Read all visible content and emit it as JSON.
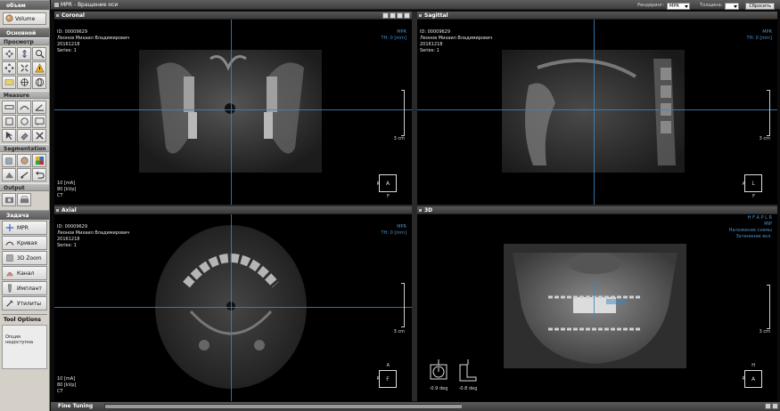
{
  "sidebar": {
    "volume_panel": {
      "title": "объем",
      "button_label": "Volume"
    },
    "main_panel": {
      "title": "Основной"
    },
    "sections": {
      "view": "Просмотр",
      "measure": "Measure",
      "segmentation": "Segmentation",
      "output": "Output"
    },
    "task_panel": {
      "title": "Задача",
      "items": [
        {
          "label": "MPR",
          "icon": "mpr-icon"
        },
        {
          "label": "Кривая",
          "icon": "curve-icon"
        },
        {
          "label": "3D Zoom",
          "icon": "zoom-3d-icon"
        },
        {
          "label": "Канал",
          "icon": "canal-icon"
        },
        {
          "label": "Имплант",
          "icon": "implant-icon"
        },
        {
          "label": "Утилиты",
          "icon": "utilities-icon"
        }
      ]
    },
    "tool_options": {
      "title": "Tool Options",
      "text": "Опция недоступна"
    }
  },
  "topbar": {
    "title": "MPR - Вращение оси",
    "render_label": "Рендеринг:",
    "render_value": "MPR",
    "thickness_label": "Толщина:",
    "thickness_value": "",
    "reset_label": "Сбросить"
  },
  "patient": {
    "id": "ID: 00009629",
    "name": "Леонов Михаил Владимирович",
    "date": "20161218",
    "series": "Series: 1",
    "ma": "10 [mA]",
    "kvp": "80 [kVp]",
    "modality": "CT"
  },
  "viewports": {
    "coronal": {
      "title": "Coronal",
      "mode": "MPR",
      "th": "TH: 0 [mm]",
      "scale": "3 cm",
      "box": "A",
      "left": "R",
      "bottom": "F"
    },
    "sagittal": {
      "title": "Sagittal",
      "mode": "MPR",
      "th": "TH: 0 [mm]",
      "scale": "3 cm",
      "box": "L",
      "left": "A",
      "bottom": "F"
    },
    "axial": {
      "title": "Axial",
      "mode": "MPR",
      "th": "TH: 0 [mm]",
      "scale": "3 cm",
      "box": "F",
      "left": "R",
      "top": "A"
    },
    "view3d": {
      "title": "3D",
      "orient_letters": "H F A P L R",
      "mode": "MIP",
      "overlay1": "Наложение схемы",
      "overlay2": "Затенение вкл.",
      "scale": "3 cm",
      "box": "A",
      "left": "R",
      "top": "H",
      "deg1": "-0.9 deg",
      "deg2": "-0.8 deg"
    }
  },
  "bottombar": {
    "title": "Fine Tuning"
  },
  "colors": {
    "accent_blue": "#3a86c0",
    "info_blue": "#4a90c8"
  }
}
